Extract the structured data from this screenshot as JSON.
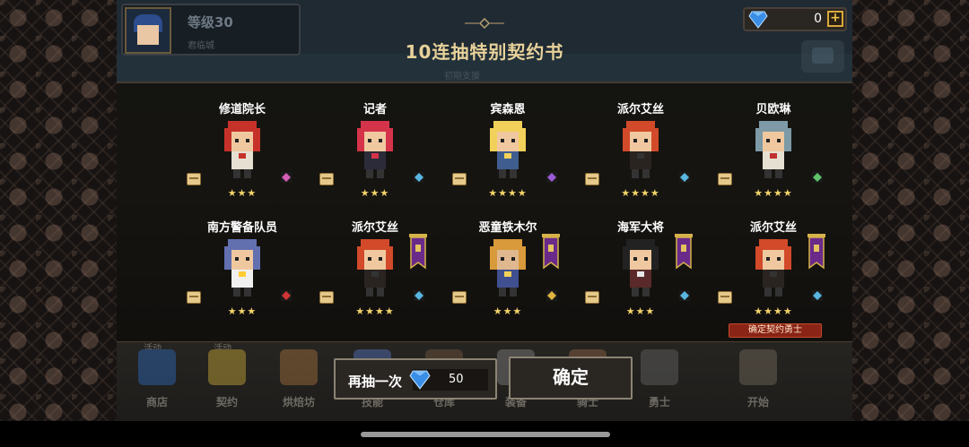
{
  "player": {
    "level": "等级30",
    "subtitle": "君临城"
  },
  "currency": {
    "gems": "0",
    "plus_label": "+"
  },
  "dialog": {
    "title": "10连抽特别契约书",
    "subtitle": "初期支援"
  },
  "results": [
    {
      "name": "修道院长",
      "stars": "★★★",
      "role_color": "#d35db5",
      "palette": {
        "hair": "#c6322a",
        "skin": "#f0c8a0",
        "body": "#e6e0d2",
        "accent": "#c6322a"
      }
    },
    {
      "name": "记者",
      "stars": "★★★",
      "role_color": "#58b6e0",
      "palette": {
        "hair": "#d5334a",
        "skin": "#f0c8a0",
        "body": "#2b2b3a",
        "accent": "#d5334a"
      }
    },
    {
      "name": "宾森恩",
      "stars": "★★★★",
      "role_color": "#9b5ad6",
      "palette": {
        "hair": "#f2d15a",
        "skin": "#f0c8a0",
        "body": "#3f5d8f",
        "accent": "#f2d15a"
      }
    },
    {
      "name": "派尔艾丝",
      "stars": "★★★★",
      "role_color": "#58b6e0",
      "palette": {
        "hair": "#d24a2a",
        "skin": "#f0c8a0",
        "body": "#2a2420",
        "accent": "#333"
      }
    },
    {
      "name": "贝欧琳",
      "stars": "★★★★",
      "role_color": "#5ec26a",
      "palette": {
        "hair": "#7d9aa6",
        "skin": "#f0c8a0",
        "body": "#e6e0d2",
        "accent": "#c03030"
      }
    },
    {
      "name": "南方警备队员",
      "stars": "★★★",
      "role_color": "#d03434",
      "palette": {
        "hair": "#6270b0",
        "skin": "#f0c8a0",
        "body": "#f0f0f0",
        "accent": "#ffcc33"
      }
    },
    {
      "name": "派尔艾丝",
      "stars": "★★★★",
      "role_color": "#58b6e0",
      "palette": {
        "hair": "#d24a2a",
        "skin": "#f0c8a0",
        "body": "#2a2420",
        "accent": "#333"
      },
      "banner": true
    },
    {
      "name": "恶童铁木尔",
      "stars": "★★★",
      "role_color": "#e0b440",
      "palette": {
        "hair": "#d89a3a",
        "skin": "#e0b890",
        "body": "#3f4f8f",
        "accent": "#f2d15a"
      },
      "banner": true
    },
    {
      "name": "海军大将",
      "stars": "★★★",
      "role_color": "#58b6e0",
      "palette": {
        "hair": "#222",
        "skin": "#f0c8a0",
        "body": "#5a2a2a",
        "accent": "#e8e8e8"
      },
      "banner": true
    },
    {
      "name": "派尔艾丝",
      "stars": "★★★★",
      "role_color": "#58b6e0",
      "palette": {
        "hair": "#d24a2a",
        "skin": "#f0c8a0",
        "body": "#2a2420",
        "accent": "#333"
      },
      "banner": true,
      "badge": "确定契约勇士"
    }
  ],
  "nav": [
    {
      "label": "商店",
      "tag": "活动",
      "color": "#2f6fc8"
    },
    {
      "label": "契约",
      "tag": "活动",
      "color": "#d8b43a"
    },
    {
      "label": "烘焙坊",
      "tag": "",
      "color": "#b07a40"
    },
    {
      "label": "技能",
      "tag": "",
      "color": "#5a7ad0"
    },
    {
      "label": "仓库",
      "tag": "",
      "color": "#7a5a40"
    },
    {
      "label": "装备",
      "tag": "",
      "color": "#8a8a8a"
    },
    {
      "label": "骑士",
      "tag": "",
      "color": "#9a6a4a"
    },
    {
      "label": "勇士",
      "tag": "",
      "color": "#6a6a6a"
    },
    {
      "label": "开始",
      "tag": "",
      "color": "#7a7060"
    }
  ],
  "actions": {
    "retry_label": "再抽一次",
    "retry_cost": "50",
    "confirm_label": "确定"
  },
  "colors": {
    "gem": "#3a8ee6",
    "star": "#f3d36a",
    "title": "#e8d29a"
  }
}
